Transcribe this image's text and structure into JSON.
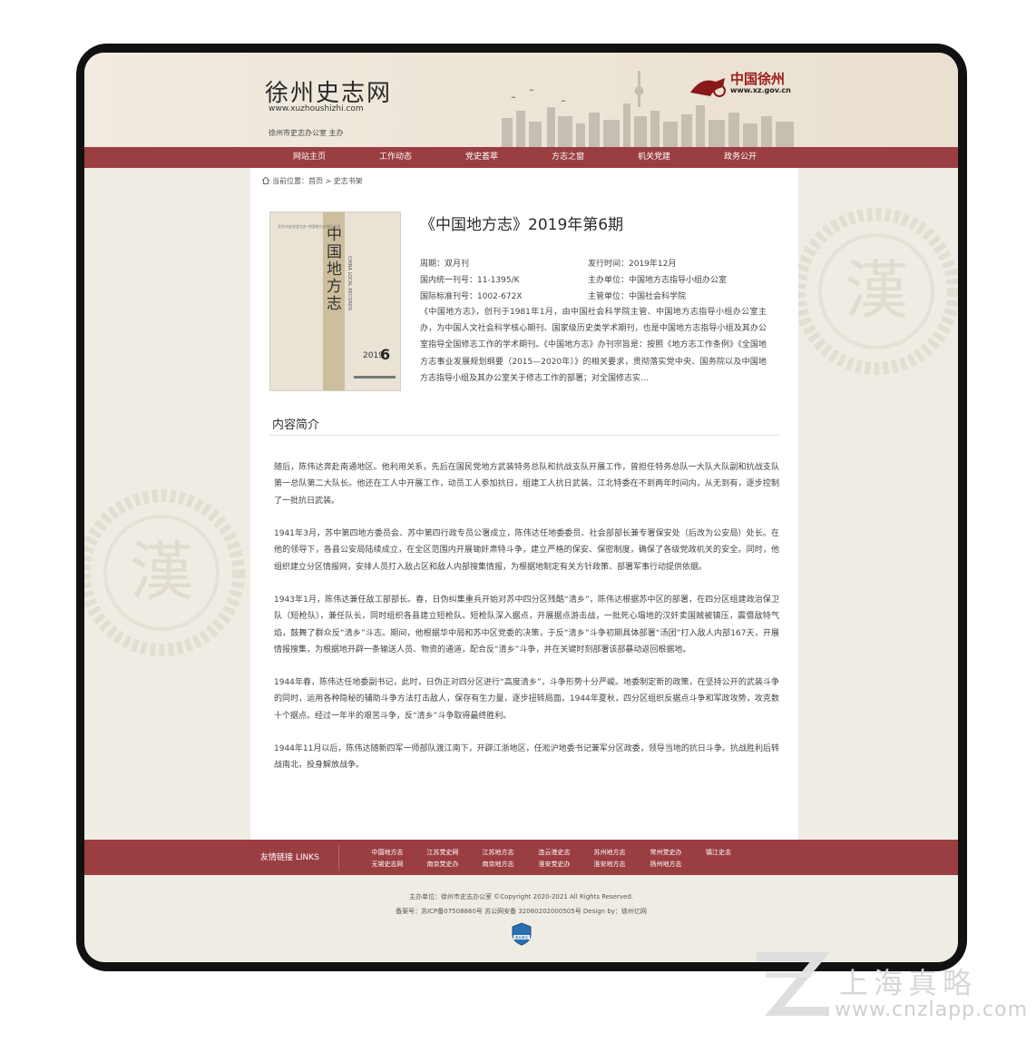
{
  "header": {
    "site_title": "徐州史志网",
    "site_url": "www.xuzhoushizhi.com",
    "host": "徐州市史志办公室 主办",
    "brand_name": "中国徐州",
    "brand_url": "www.xz.gov.cn"
  },
  "nav": {
    "items": [
      {
        "label": "网站主页"
      },
      {
        "label": "工作动态"
      },
      {
        "label": "党史荟萃"
      },
      {
        "label": "方志之窗"
      },
      {
        "label": "机关党建"
      },
      {
        "label": "政务公开"
      }
    ]
  },
  "breadcrumb": {
    "prefix": "当前位置：",
    "home": "首页",
    "sep": " > ",
    "current": "史志书架"
  },
  "cover": {
    "small_text": "北京市史学会主办 中国地方志指导小组",
    "title": "中国地方志",
    "english": "CHINA LOCAL RECORDS",
    "year": "2019",
    "issue": "6"
  },
  "book": {
    "title": "《中国地方志》2019年第6期",
    "meta": [
      {
        "label": "周期：双月刊",
        "key": "period"
      },
      {
        "label": "发行时间：2019年12月",
        "key": "release"
      },
      {
        "label": "国内统一刊号：11-1395/K",
        "key": "cn"
      },
      {
        "label": "主办单位：中国地方志指导小组办公室",
        "key": "sponsor"
      },
      {
        "label": "国际标准刊号：1002-672X",
        "key": "issn"
      },
      {
        "label": "主管单位：中国社会科学院",
        "key": "supervisor"
      }
    ],
    "description": "《中国地方志》，创刊于1981年1月，由中国社会科学院主管、中国地方志指导小组办公室主办，为中国人文社会科学核心期刊、国家级历史类学术期刊，也是中国地方志指导小组及其办公室指导全国修志工作的学术期刊。《中国地方志》办刊宗旨是：按照《地方志工作条例》《全国地方志事业发展规划纲要（2015—2020年）》的相关要求，贯彻落实党中央、国务院以及中国地方志指导小组及其办公室关于修志工作的部署；对全国修志实..."
  },
  "intro": {
    "title": "内容简介",
    "paragraphs": [
      "随后，陈伟达奔赴南通地区。他利用关系，先后在国民党地方武装特务总队和抗战支队开展工作，曾担任特务总队一大队大队副和抗战支队第一总队第二大队长。他还在工人中开展工作，动员工人参加抗日，组建工人抗日武装。江北特委在不到两年时间内，从无到有，逐步控制了一批抗日武装。",
      "1941年3月，苏中第四地方委员会、苏中第四行政专员公署成立，陈伟达任地委委员、社会部部长兼专署保安处（后改为公安局）处长。在他的领导下，各县公安局陆续成立，在全区范围内开展锄奸肃特斗争，建立严格的保安、保密制度，确保了各级党政机关的安全。同时，他组织建立分区情报网，安排人员打入敌占区和敌人内部搜集情报，为根据地制定有关方针政策、部署军事行动提供依据。",
      "1943年1月，陈伟达兼任敌工部部长。春，日伪纠集重兵开始对苏中四分区残酷“清乡”，陈伟达根据苏中区的部署，在四分区组建政治保卫队（短枪队），兼任队长，同时组织各县建立短枪队。短枪队深入据点，开展据点游击战，一批死心塌地的汉奸卖国贼被镇压，震慑敌特气焰，鼓舞了群众反“清乡”斗志。期间，他根据华中局和苏中区党委的决策，于反“清乡”斗争初期具体部署“汤团”打入敌人内部167天，开展情报搜集，为根据地开辟一条输送人员、物资的通道，配合反“清乡”斗争，并在关键时刻部署该部暴动返回根据地。",
      "1944年春，陈伟达任地委副书记，此时，日伪正对四分区进行“高度清乡”，斗争形势十分严峻。地委制定新的政策，在坚持公开的武装斗争的同时，运用各种隐秘的辅助斗争方法打击敌人，保存有生力量，逐步扭转局面。1944年夏秋，四分区组织反据点斗争和军政攻势，攻克数十个据点。经过一年半的艰苦斗争，反“清乡”斗争取得最终胜利。",
      "1944年11月以后，陈伟达随新四军一师部队渡江南下，开辟江浙地区，任淞沪地委书记兼军分区政委，领导当地的抗日斗争。抗战胜利后转战南北，投身解放战争。"
    ]
  },
  "footer": {
    "links_label": "友情链接 LINKS",
    "links_row1": [
      "中国地方志",
      "江苏党史网",
      "江苏地方志",
      "连云港史志",
      "苏州地方志",
      "常州党史办",
      "镇江史志"
    ],
    "links_row2": [
      "无锡史志网",
      "南京党史办",
      "南京地方志",
      "淮安党史办",
      "淮安地方志",
      "扬州地方志"
    ],
    "copyright": "主办单位：徐州市史志办公室 ©Copyright 2020-2021 All Rights Reserved.",
    "record": "备案号：苏ICP备07508860号 苏公网安备 32060202000505号 Design by：徐州亿网",
    "police_label": "事业单位"
  },
  "watermark": {
    "corner_cn": "上海真略",
    "corner_url": "www.cnzlapp.com",
    "seal_char": "漢"
  },
  "colors": {
    "nav_bg": "#9b3e41",
    "brand_red": "#9c1b1b",
    "page_bg": "#efece4"
  }
}
